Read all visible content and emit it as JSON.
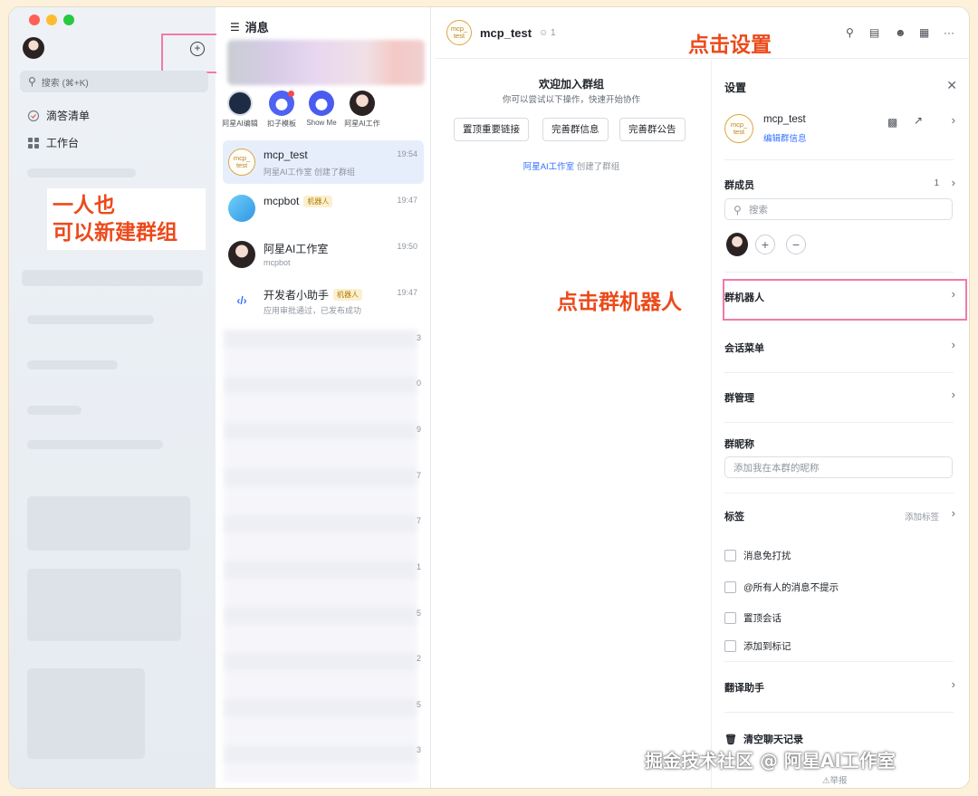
{
  "sidebar": {
    "search_placeholder": "搜索 (⌘+K)",
    "items": [
      {
        "label": "滴答清单",
        "icon": "todo-icon"
      },
      {
        "label": "工作台",
        "icon": "grid-icon"
      }
    ],
    "annotation_line1": "一人也",
    "annotation_line2": "可以新建群组"
  },
  "message_list": {
    "title": "消息",
    "quick_apps": [
      {
        "label": "阿星AI编辑"
      },
      {
        "label": "扣子模板"
      },
      {
        "label": "Show Me"
      },
      {
        "label": "阿星AI工作"
      }
    ],
    "chats": [
      {
        "name": "mcp_test",
        "sub": "阿星AI工作室 创建了群组",
        "time": "19:54",
        "bot": ""
      },
      {
        "name": "mcpbot",
        "sub": "",
        "time": "19:47",
        "bot": "机器人"
      },
      {
        "name": "阿星AI工作室",
        "sub": "mcpbot",
        "time": "19:50",
        "bot": ""
      },
      {
        "name": "开发者小助手",
        "sub": "应用审批通过，已发布成功",
        "time": "19:47",
        "bot": "机器人"
      }
    ],
    "blurred_digits": [
      "3",
      "0",
      "9",
      "7",
      "7",
      "1",
      "5",
      "2",
      "5",
      "3"
    ]
  },
  "chat": {
    "title": "mcp_test",
    "member_count": "1",
    "logo_text_1": "mcp_",
    "logo_text_2": "test",
    "welcome_title": "欢迎加入群组",
    "welcome_sub": "你可以尝试以下操作，快速开始协作",
    "buttons": [
      "置顶重要链接",
      "完善群信息",
      "完善群公告"
    ],
    "created_who": "阿星AI工作室",
    "created_text": " 创建了群组",
    "annotation_settings": "点击设置",
    "annotation_bot": "点击群机器人"
  },
  "settings": {
    "title": "设置",
    "group_name": "mcp_test",
    "edit_info": "编辑群信息",
    "members_label": "群成员",
    "members_count": "1",
    "member_search_placeholder": "搜索",
    "group_bot": "群机器人",
    "session_menu": "会话菜单",
    "group_manage": "群管理",
    "nickname_label": "群昵称",
    "nickname_placeholder": "添加我在本群的昵称",
    "tags_label": "标签",
    "add_tag": "添加标签",
    "checkboxes": [
      "消息免打扰",
      "@所有人的消息不提示",
      "置顶会话",
      "添加到标记"
    ],
    "translate": "翻译助手",
    "clear_history": "清空聊天记录"
  },
  "watermark": "掘金技术社区 @ 阿星AI工作室",
  "report": "⚠举报",
  "colors": {
    "accent": "#3370ff",
    "annotation": "#ec4a1b",
    "highlight": "#f07aa8"
  }
}
